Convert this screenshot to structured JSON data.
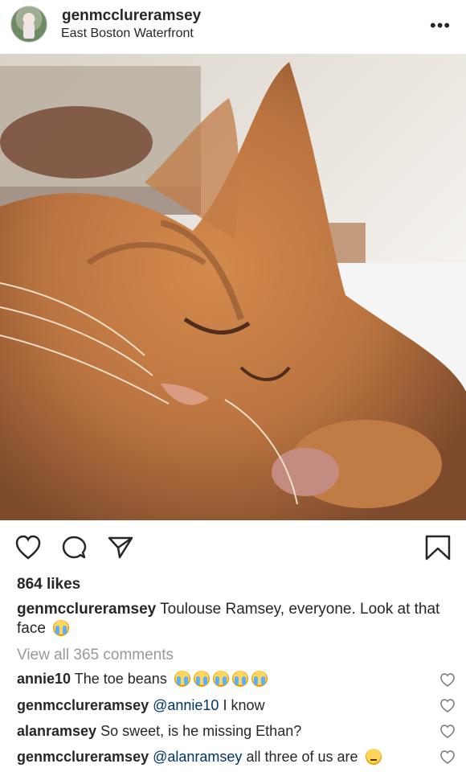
{
  "post": {
    "username": "genmcclureramsey",
    "location": "East Boston Waterfront",
    "more_label": "•••",
    "likes": "864 likes",
    "caption": {
      "username": "genmcclureramsey",
      "text": "Toulouse Ramsey, everyone. Look at that face"
    },
    "view_all": "View all 365 comments",
    "photo_subject": "orange tabby cat sleeping"
  },
  "comments": [
    {
      "username": "annie10",
      "text": "The toe beans"
    },
    {
      "username": "genmcclureramsey",
      "mention": "@annie10",
      "text": " I know"
    },
    {
      "username": "alanramsey",
      "text": "So sweet, is he missing Ethan?"
    },
    {
      "username": "genmcclureramsey",
      "mention": "@alanramsey",
      "text": " all three of us are"
    }
  ],
  "icons": {
    "heart": "heart-icon",
    "comment": "comment-icon",
    "share": "share-icon",
    "save": "bookmark-icon"
  },
  "colors": {
    "text": "#262626",
    "secondary": "#999999",
    "mention": "#003569"
  }
}
